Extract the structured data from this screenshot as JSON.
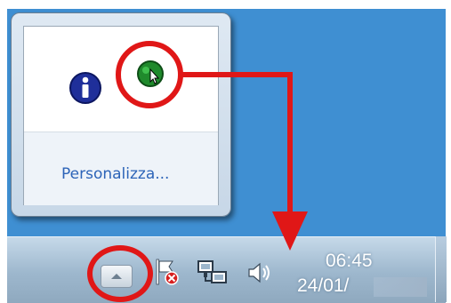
{
  "flyout": {
    "customize_label": "Personalizza...",
    "icons": [
      "info-icon",
      "green-app-icon"
    ]
  },
  "taskbar": {
    "tray_icons": [
      "show-hidden-icons-button",
      "action-center-flag-icon",
      "network-icon",
      "volume-icon"
    ],
    "clock": {
      "time": "06:45",
      "date": "24/01/"
    }
  },
  "annotations": {
    "highlight_color": "#e01717"
  }
}
